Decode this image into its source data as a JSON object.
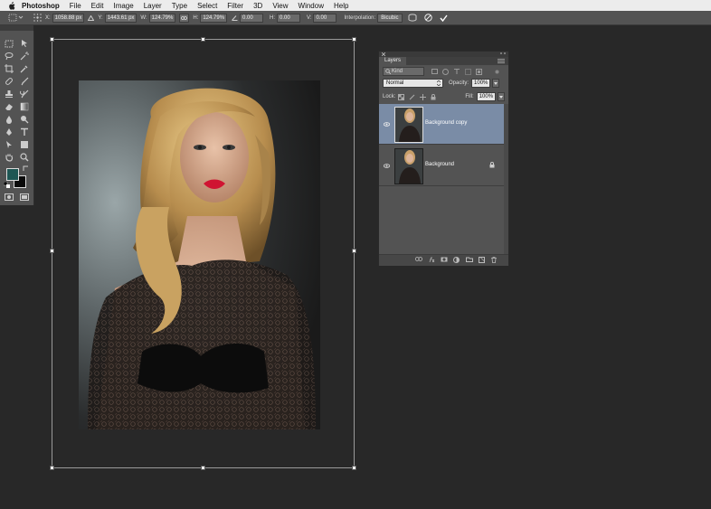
{
  "menubar": {
    "apple_icon": "apple-icon",
    "app_name": "Photoshop",
    "items": [
      "File",
      "Edit",
      "Image",
      "Layer",
      "Type",
      "Select",
      "Filter",
      "3D",
      "View",
      "Window",
      "Help"
    ]
  },
  "options": {
    "x_label": "X:",
    "x_value": "1058.88 px",
    "y_label": "Y:",
    "y_value": "1443.61 px",
    "w_label": "W:",
    "w_value": "124.79%",
    "h_label": "H:",
    "h_value": "124.79%",
    "angle_value": "0.00",
    "h_skew_label": "H:",
    "h_skew_value": "0.00",
    "v_skew_label": "V:",
    "v_skew_value": "0.00",
    "interp_label": "Interpolation:",
    "interp_value": "Bicubic",
    "cancel_icon": "cancel-icon",
    "commit_icon": "checkmark-icon"
  },
  "layers_panel": {
    "tab": "Layers",
    "filter_placeholder": "Kind",
    "blend_mode": "Normal",
    "opacity_label": "Opacity:",
    "opacity_value": "100%",
    "lock_label": "Lock:",
    "fill_label": "Fill:",
    "fill_value": "100%",
    "layers": [
      {
        "name": "Background copy",
        "selected": true
      },
      {
        "name": "Background",
        "selected": false,
        "locked": true
      }
    ]
  },
  "colors": {
    "accent_selected_layer": "#7a8ca6",
    "foreground_swatch": "#1e5653",
    "background_swatch": "#0a0a0a"
  }
}
